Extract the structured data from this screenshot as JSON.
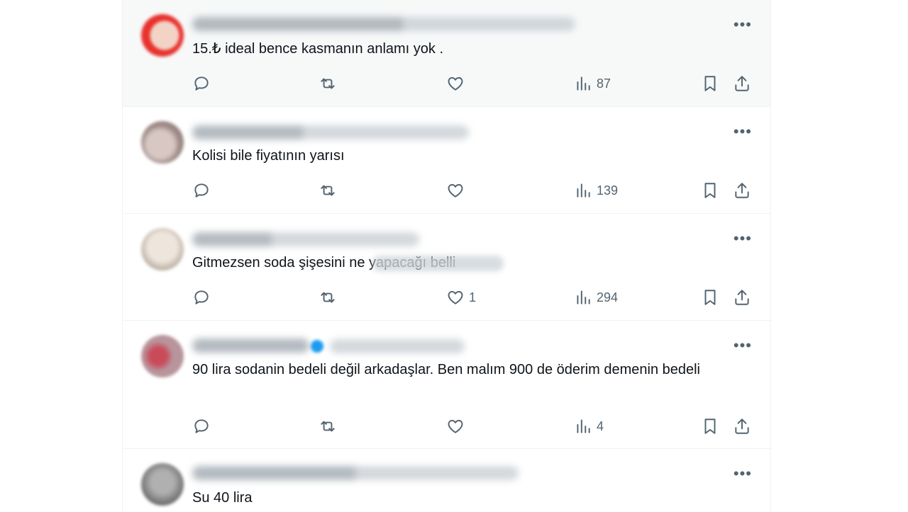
{
  "tweets": [
    {
      "text": "15.₺ ideal bence kasmanın anlamı yok .",
      "views": "87",
      "likes": "",
      "avatar_color": "#e8322e"
    },
    {
      "text": "Kolisi bile fiyatının yarısı",
      "views": "139",
      "likes": "",
      "avatar_color": "#b9a7a2"
    },
    {
      "text": "Gitmezsen soda şişesini ne yapacağı belli",
      "views": "294",
      "likes": "1",
      "avatar_color": "#d9ccc0"
    },
    {
      "text": "90 lira sodanin bedeli değil arkadaşlar. Ben malım 900 de öderim demenin bedeli",
      "views": "4",
      "likes": "",
      "avatar_color": "#b88290"
    },
    {
      "text": "Su 40 lira",
      "views": "",
      "likes": "",
      "avatar_color": "#8e8e8e"
    }
  ],
  "icons": {
    "reply": "reply-icon",
    "repost": "repost-icon",
    "like": "heart-icon",
    "views": "views-chart-icon",
    "bookmark": "bookmark-icon",
    "share": "share-icon",
    "more": "more-dots-icon"
  },
  "more_glyph": "•••",
  "colors": {
    "icon": "#536471",
    "text": "#0f1419",
    "divider": "#eff3f4",
    "highlight": "#f7f9f9"
  }
}
